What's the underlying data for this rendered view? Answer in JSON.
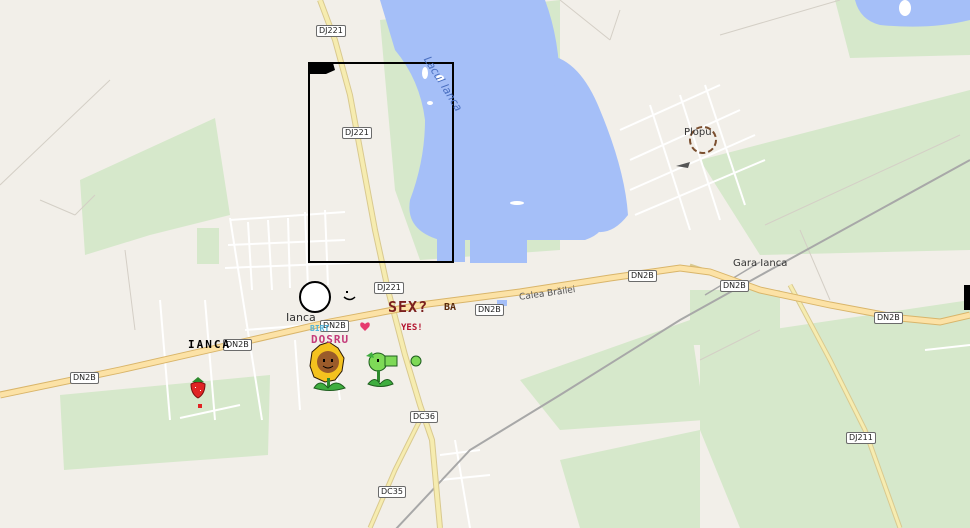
{
  "map": {
    "places": {
      "town": "Ianca",
      "village": "Plopu",
      "station": "Gara Ianca",
      "lake": "Lacul Ianca",
      "street": "Calea Brăilei"
    },
    "road_refs": {
      "dj221_top": "DJ221",
      "dj221_mid": "DJ221",
      "dj221_low": "DJ221",
      "dn2b_left": "DN2B",
      "dn2b_center_a": "DN2B",
      "dn2b_center_b": "DN2B",
      "dn2b_mid": "DN2B",
      "dn2b_station": "DN2B",
      "dn2b_right": "DN2B",
      "dc36": "DC36",
      "dc35": "DC35",
      "dj211": "DJ211"
    },
    "overlay_text": {
      "ianca_pixel": "IANCA",
      "sexy": "SEX?",
      "ba": "BA",
      "yes": "YES!",
      "dosru": "DOSRU",
      "blue_word": "BIRT"
    },
    "colors": {
      "land": "#f2efe9",
      "water": "#a5bff8",
      "green": "#d6e8cb",
      "road_primary": "#fce2a6",
      "road_secondary": "#f6ecb0"
    }
  }
}
